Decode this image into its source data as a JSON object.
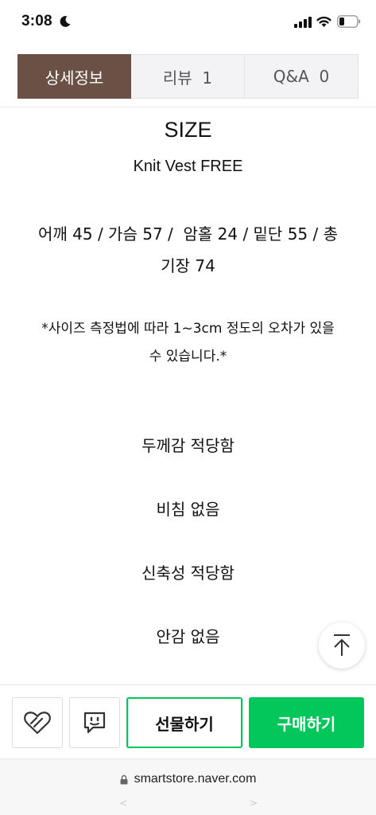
{
  "status_bar": {
    "time": "3:08"
  },
  "tabs": [
    {
      "label": "상세정보",
      "active": true
    },
    {
      "label": "리뷰  1",
      "active": false
    },
    {
      "label": "Q&A  0",
      "active": false
    }
  ],
  "content": {
    "size_title": "SIZE",
    "product_name": "Knit Vest FREE",
    "measurements_line1": "어깨 45 / 가슴 57 /  암홀 24 / 밑단 55 / 총",
    "measurements_line2": "기장 74",
    "note_line1": "*사이즈 측정법에 따라 1~3cm 정도의 오차가 있을",
    "note_line2": "수 있습니다.*",
    "details": [
      "두께감 적당함",
      "비침 없음",
      "신축성 적당함",
      "안감 없음"
    ]
  },
  "actions": {
    "gift_label": "선물하기",
    "buy_label": "구매하기"
  },
  "url_bar": {
    "url": "smartstore.naver.com"
  },
  "colors": {
    "tab_active": "#6b5045",
    "accent_green": "#03c75a"
  },
  "icons": {
    "like": "heart-icon",
    "talk": "talk-icon",
    "scroll_top": "arrow-up-icon",
    "lock": "lock-icon"
  }
}
